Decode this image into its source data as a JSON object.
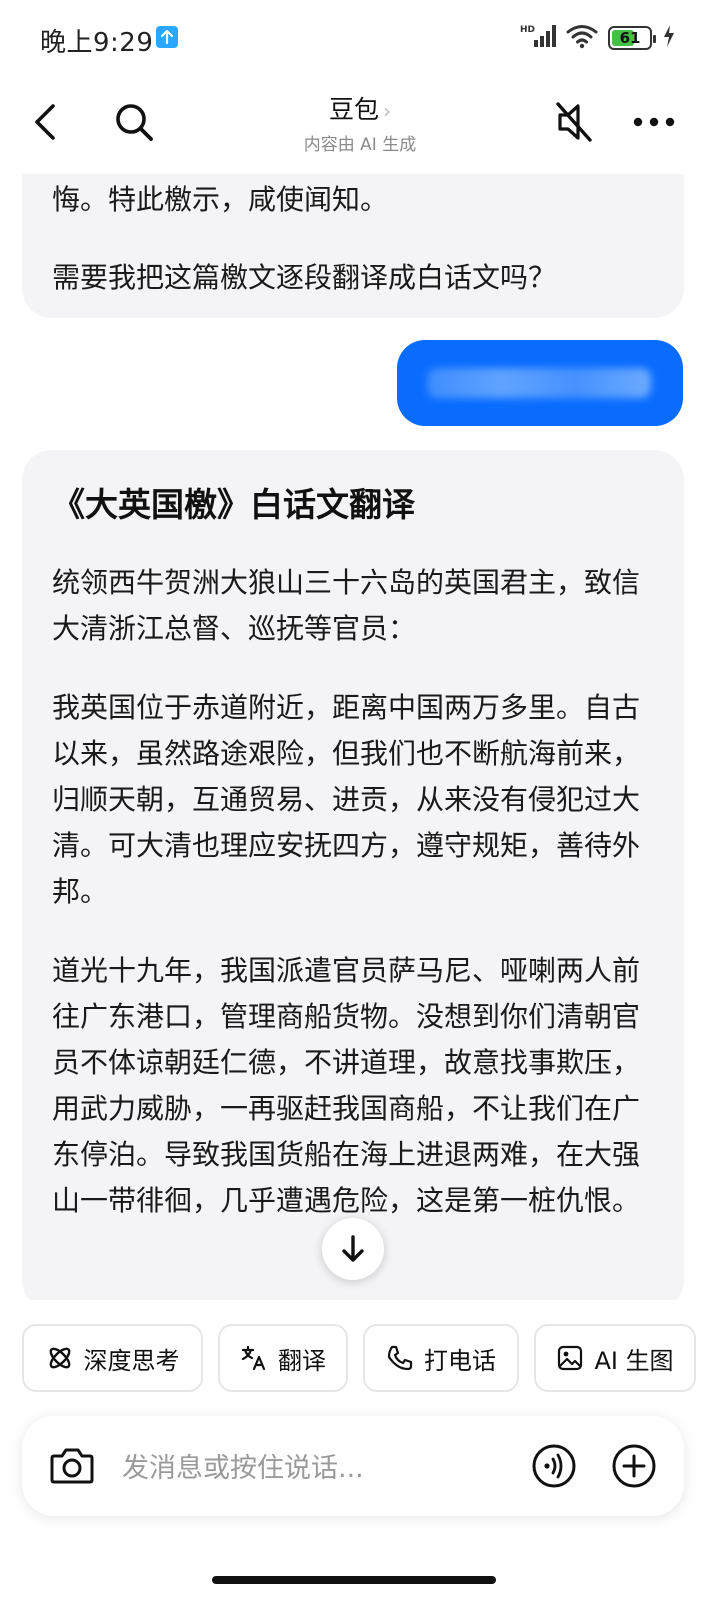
{
  "status_bar": {
    "time": "晚上9:29",
    "battery": "61",
    "icons": [
      "upload-icon",
      "hd-signal-icon",
      "wifi-icon",
      "battery-icon",
      "charging-icon"
    ]
  },
  "header": {
    "title": "豆包",
    "title_chevron": "›",
    "subtitle": "内容由 AI 生成"
  },
  "chat": {
    "prev_message": {
      "line1": "悔。特此檄示，咸使闻知。",
      "line2": "需要我把这篇檄文逐段翻译成白话文吗？"
    },
    "user_message": {
      "text": "",
      "blurred": true
    },
    "reply": {
      "title": "《大英国檄》白话文翻译",
      "paragraphs": [
        "统领西牛贺洲大狼山三十六岛的英国君主，致信大清浙江总督、巡抚等官员：",
        "我英国位于赤道附近，距离中国两万多里。自古以来，虽然路途艰险，但我们也不断航海前来，归顺天朝，互通贸易、进贡，从来没有侵犯过大清。可大清也理应安抚四方，遵守规矩，善待外邦。",
        "道光十九年，我国派遣官员萨马尼、哑喇两人前往广东港口，管理商船货物。没想到你们清朝官员不体谅朝廷仁德，不讲道理，故意找事欺压，用武力威胁，一再驱赶我国商船，不让我们在广东停泊。导致我国货船在海上进退两难，在大强山一带徘徊，几乎遭遇危险，这是第一桩仇恨。"
      ]
    }
  },
  "quick_actions": [
    {
      "label": "深度思考",
      "icon": "atom-icon"
    },
    {
      "label": "翻译",
      "icon": "translate-icon"
    },
    {
      "label": "打电话",
      "icon": "phone-icon"
    },
    {
      "label": "AI 生图",
      "icon": "image-icon"
    }
  ],
  "input": {
    "placeholder": "发消息或按住说话..."
  },
  "colors": {
    "accent": "#0a6cff",
    "bubble_bg": "#f4f4f6",
    "battery": "#43c146"
  }
}
